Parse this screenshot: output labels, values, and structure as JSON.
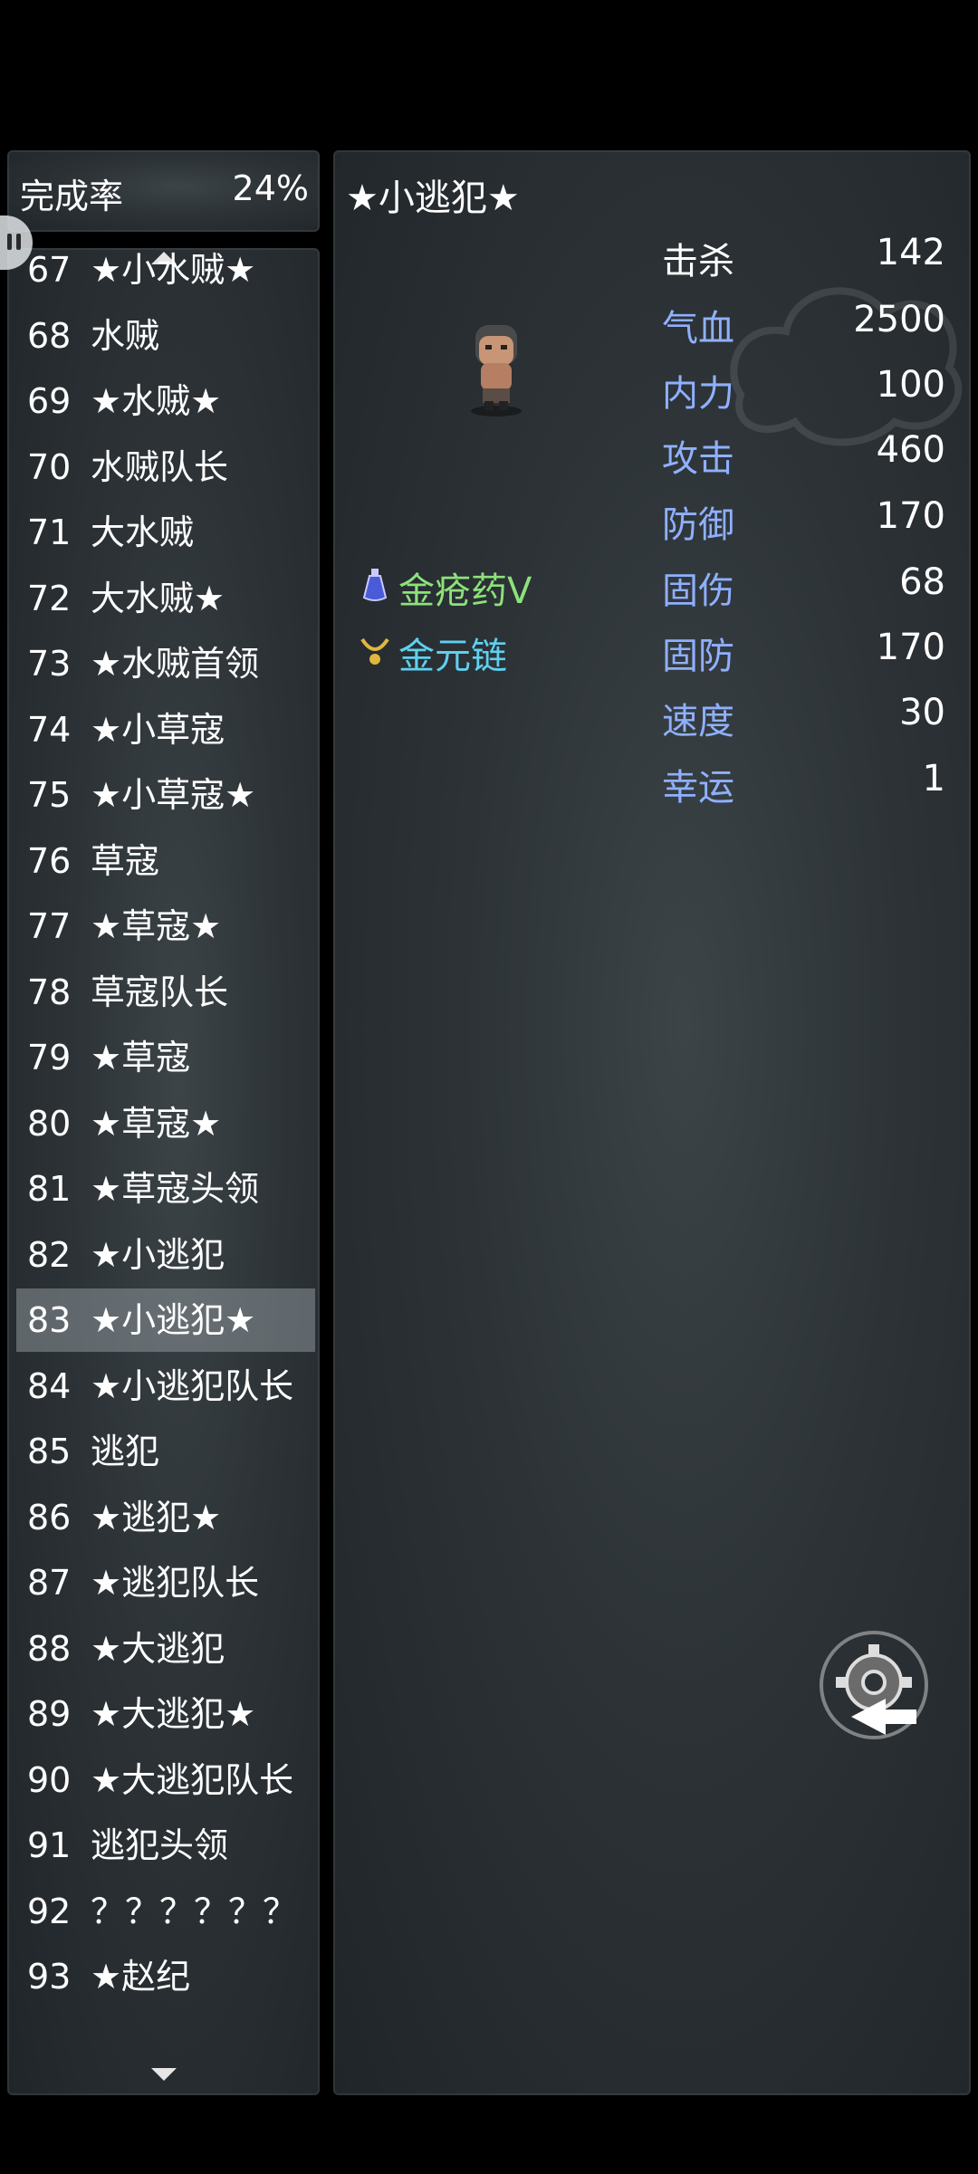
{
  "completion": {
    "label": "完成率",
    "value": "24%"
  },
  "list": {
    "items": [
      {
        "num": "67",
        "name": "★小水贼★"
      },
      {
        "num": "68",
        "name": "水贼"
      },
      {
        "num": "69",
        "name": "★水贼★"
      },
      {
        "num": "70",
        "name": "水贼队长"
      },
      {
        "num": "71",
        "name": "大水贼"
      },
      {
        "num": "72",
        "name": "大水贼★"
      },
      {
        "num": "73",
        "name": "★水贼首领"
      },
      {
        "num": "74",
        "name": "★小草寇"
      },
      {
        "num": "75",
        "name": "★小草寇★"
      },
      {
        "num": "76",
        "name": "草寇"
      },
      {
        "num": "77",
        "name": "★草寇★"
      },
      {
        "num": "78",
        "name": "草寇队长"
      },
      {
        "num": "79",
        "name": "★草寇"
      },
      {
        "num": "80",
        "name": "★草寇★"
      },
      {
        "num": "81",
        "name": "★草寇头领"
      },
      {
        "num": "82",
        "name": "★小逃犯"
      },
      {
        "num": "83",
        "name": "★小逃犯★"
      },
      {
        "num": "84",
        "name": "★小逃犯队长"
      },
      {
        "num": "85",
        "name": "逃犯"
      },
      {
        "num": "86",
        "name": "★逃犯★"
      },
      {
        "num": "87",
        "name": "★逃犯队长"
      },
      {
        "num": "88",
        "name": "★大逃犯"
      },
      {
        "num": "89",
        "name": "★大逃犯★"
      },
      {
        "num": "90",
        "name": "★大逃犯队长"
      },
      {
        "num": "91",
        "name": "逃犯头领"
      },
      {
        "num": "92",
        "name": "？？？？？？"
      },
      {
        "num": "93",
        "name": "★赵纪"
      }
    ],
    "selected_num": "83"
  },
  "detail": {
    "title": "★小逃犯★",
    "stats": [
      {
        "label": "击杀",
        "value": "142",
        "color": "#ffffff"
      },
      {
        "label": "气血",
        "value": "2500",
        "color": "#8fb0ff"
      },
      {
        "label": "内力",
        "value": "100",
        "color": "#8fb0ff"
      },
      {
        "label": "攻击",
        "value": "460",
        "color": "#8fb0ff"
      },
      {
        "label": "防御",
        "value": "170",
        "color": "#8fb0ff"
      },
      {
        "label": "固伤",
        "value": "68",
        "color": "#8fb0ff"
      },
      {
        "label": "固防",
        "value": "170",
        "color": "#8fb0ff"
      },
      {
        "label": "速度",
        "value": "30",
        "color": "#8fb0ff"
      },
      {
        "label": "幸运",
        "value": "1",
        "color": "#8fb0ff"
      }
    ],
    "drops": [
      {
        "name": "金疮药V",
        "color": "#8de27a",
        "icon": "potion-icon"
      },
      {
        "name": "金元链",
        "color": "#5fd0f0",
        "icon": "necklace-icon"
      }
    ]
  },
  "icons": {
    "settings": "gear-back-icon",
    "sprite": "character-sprite"
  },
  "colors": {
    "panel_bg": "#2c3236",
    "stat_label_blue": "#8fb0ff",
    "drop_green": "#8de27a",
    "drop_cyan": "#5fd0f0"
  }
}
